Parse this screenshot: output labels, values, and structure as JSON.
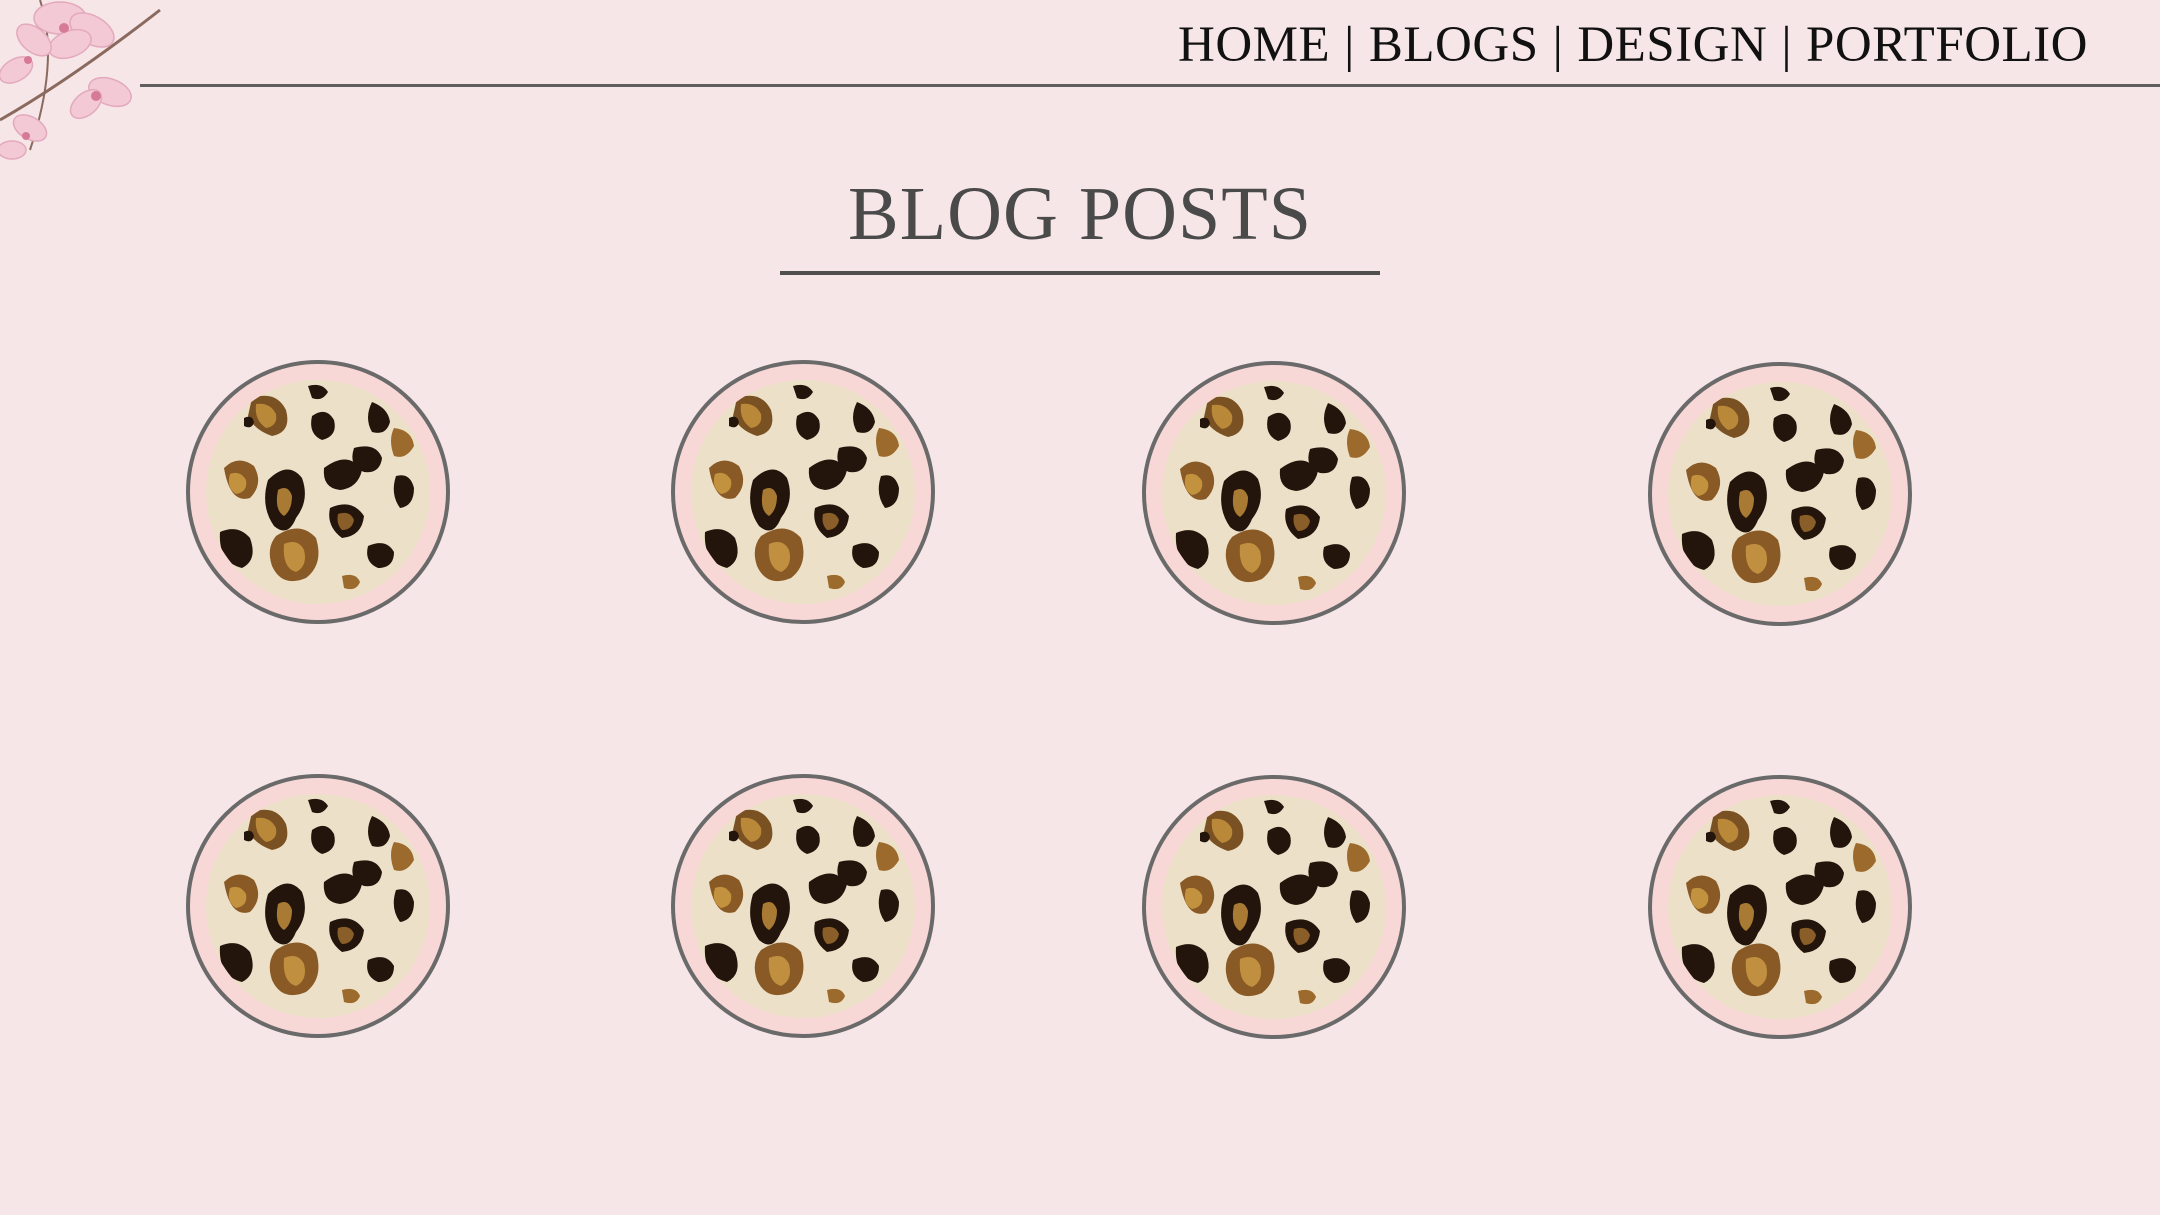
{
  "nav": {
    "items": [
      {
        "label": "HOME"
      },
      {
        "label": "BLOGS"
      },
      {
        "label": "DESIGN"
      },
      {
        "label": "PORTFOLIO"
      }
    ],
    "separator": "|"
  },
  "page_title": "BLOG POSTS",
  "icons": {
    "corner": "orchid-flowers-icon",
    "post": "leopard-print-thumbnail-icon"
  },
  "colors": {
    "background": "#f7e6e8",
    "rule": "#5f5f5f",
    "circle_border": "#6a6a6a",
    "circle_ring": "#f8d8d6"
  },
  "posts": [
    {
      "index": 1
    },
    {
      "index": 2
    },
    {
      "index": 3
    },
    {
      "index": 4
    },
    {
      "index": 5
    },
    {
      "index": 6
    },
    {
      "index": 7
    },
    {
      "index": 8
    }
  ]
}
